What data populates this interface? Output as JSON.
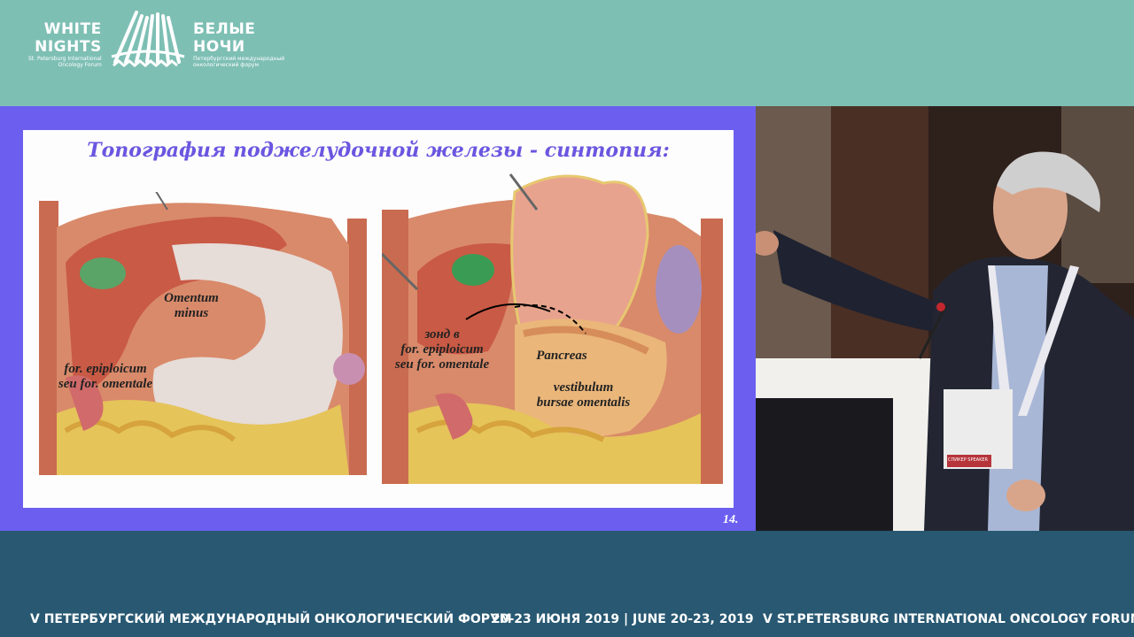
{
  "logo": {
    "en_line1": "WHITE",
    "en_line2": "NIGHTS",
    "en_sub1": "St. Petersburg International",
    "en_sub2": "Oncology Forum",
    "ru_line1": "БЕЛЫЕ",
    "ru_line2": "НОЧИ",
    "ru_sub1": "Петербургский международный",
    "ru_sub2": "онкологический форум"
  },
  "slide": {
    "title": "Топография поджелудочной железы - синтопия:",
    "number": "14.",
    "labels": {
      "omentum": "Omentum\nminus",
      "foramen_left": "for. epiploicum\nseu for. omentale",
      "probe": "зонд в\nfor. epiploicum\nseu for. omentale",
      "pancreas": "Pancreas",
      "vestibulum": "vestibulum\nbursae omentalis"
    }
  },
  "badge": {
    "text": "СПИКЕР SPEAKER"
  },
  "footer": {
    "left": "V ПЕТЕРБУРГСКИЙ МЕЖДУНАРОДНЫЙ ОНКОЛОГИЧЕСКИЙ ФОРУМ",
    "center": "20-23 ИЮНЯ 2019 | JUNE 20-23, 2019",
    "right": "V ST.PETERSBURG INTERNATIONAL ONCOLOGY FORUM"
  },
  "colors": {
    "top_bar": "#7ebfb4",
    "slide_frame": "#6c5ff0",
    "bottom_bar": "#285872",
    "title": "#6a56e0"
  }
}
